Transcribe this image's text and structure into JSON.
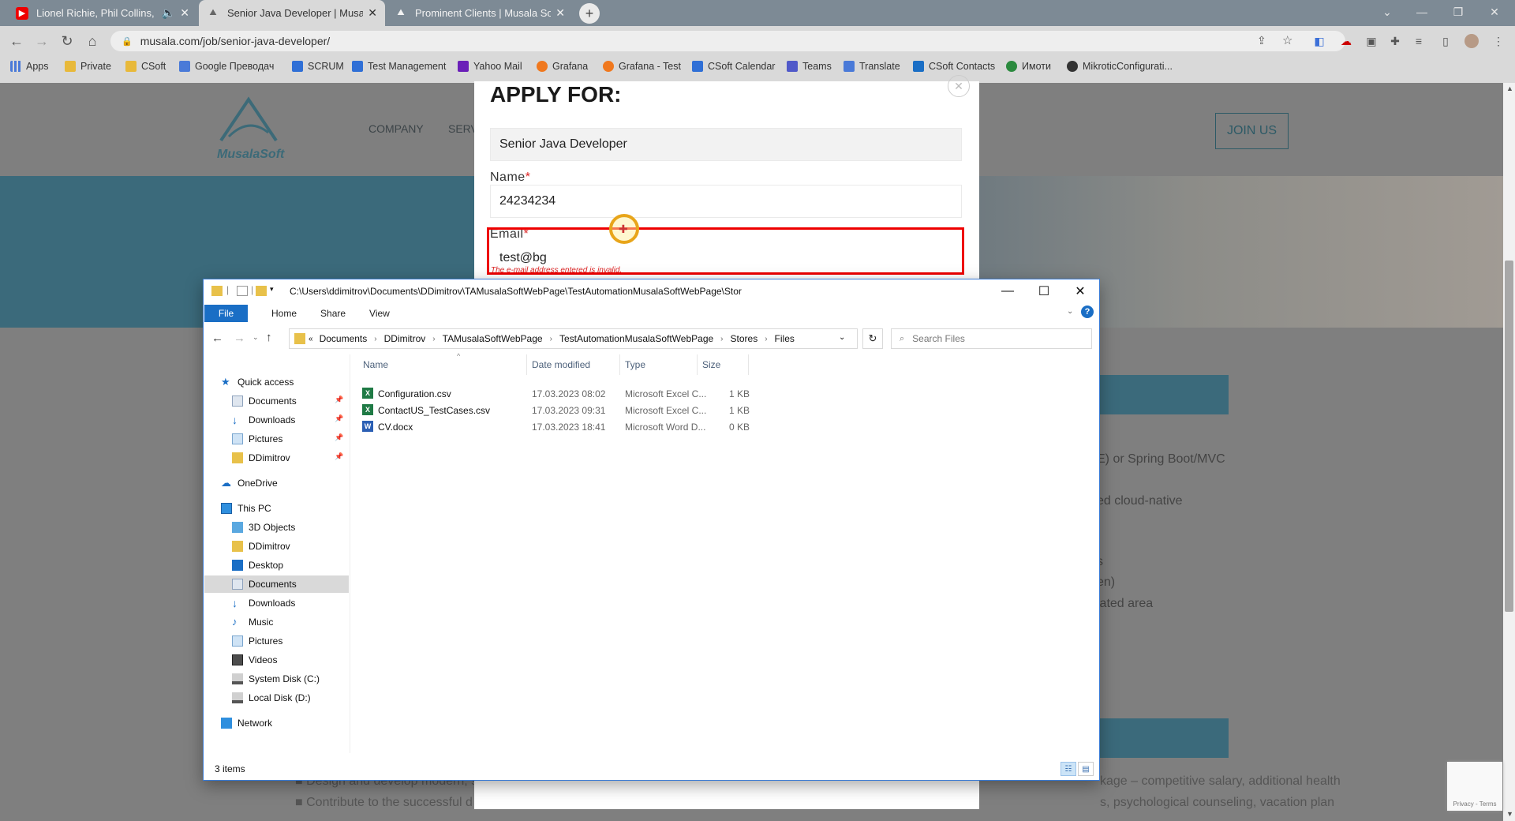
{
  "browser": {
    "tabs": [
      {
        "title": "Lionel Richie, Phil Collins, Ro",
        "icon": "youtube-icon",
        "muted_icon": "speaker-icon"
      },
      {
        "title": "Senior Java Developer | Musala S",
        "icon": "musala-icon"
      },
      {
        "title": "Prominent Clients | Musala Soft",
        "icon": "musala-icon"
      }
    ],
    "url": "musala.com/job/senior-java-developer/",
    "bookmarks": [
      "Apps",
      "Private",
      "CSoft",
      "Google Преводач",
      "SCRUM",
      "Test Management",
      "Yahoo Mail",
      "Grafana",
      "Grafana - Test",
      "CSoft Calendar",
      "Teams",
      "Translate",
      "CSoft Contacts",
      "Имоти",
      "MikroticConfigurati..."
    ]
  },
  "site": {
    "logo": "MusalaSoft",
    "nav": [
      "COMPANY",
      "SERV"
    ],
    "join_us": "JOIN US",
    "bg_text": [
      "E) or Spring Boot/MVC",
      "ed cloud-native",
      "s",
      "en)",
      "lated area",
      "Design and develop modern, s",
      "Contribute to the successful d",
      "kage – competitive salary, additional health",
      "s, psychological counseling, vacation plan"
    ]
  },
  "modal": {
    "title": "APPLY FOR:",
    "position": "Senior Java Developer",
    "name_label": "Name",
    "name_value": "24234234",
    "email_label": "Email",
    "email_value": "test@bg",
    "email_error": "The e-mail address entered is invalid.",
    "required_mark": "*",
    "close": "✕"
  },
  "explorer": {
    "title": "C:\\Users\\ddimitrov\\Documents\\DDimitrov\\TAMusalaSoftWebPage\\TestAutomationMusalaSoftWebPage\\Stor",
    "ribbon": {
      "file": "File",
      "home": "Home",
      "share": "Share",
      "view": "View"
    },
    "breadcrumb": [
      "Documents",
      "DDimitrov",
      "TAMusalaSoftWebPage",
      "TestAutomationMusalaSoftWebPage",
      "Stores",
      "Files"
    ],
    "search_placeholder": "Search Files",
    "nav": {
      "quick_access": "Quick access",
      "qa_items": [
        "Documents",
        "Downloads",
        "Pictures",
        "DDimitrov"
      ],
      "onedrive": "OneDrive",
      "this_pc": "This PC",
      "pc_items": [
        "3D Objects",
        "DDimitrov",
        "Desktop",
        "Documents",
        "Downloads",
        "Music",
        "Pictures",
        "Videos",
        "System Disk (C:)",
        "Local Disk (D:)"
      ],
      "network": "Network"
    },
    "columns": [
      "Name",
      "Date modified",
      "Type",
      "Size"
    ],
    "files": [
      {
        "name": "Configuration.csv",
        "date": "17.03.2023 08:02",
        "type": "Microsoft Excel C...",
        "size": "1 KB",
        "kind": "excel"
      },
      {
        "name": "ContactUS_TestCases.csv",
        "date": "17.03.2023 09:31",
        "type": "Microsoft Excel C...",
        "size": "1 KB",
        "kind": "excel"
      },
      {
        "name": "CV.docx",
        "date": "17.03.2023 18:41",
        "type": "Microsoft Word D...",
        "size": "0 KB",
        "kind": "word"
      }
    ],
    "status": "3 items"
  }
}
